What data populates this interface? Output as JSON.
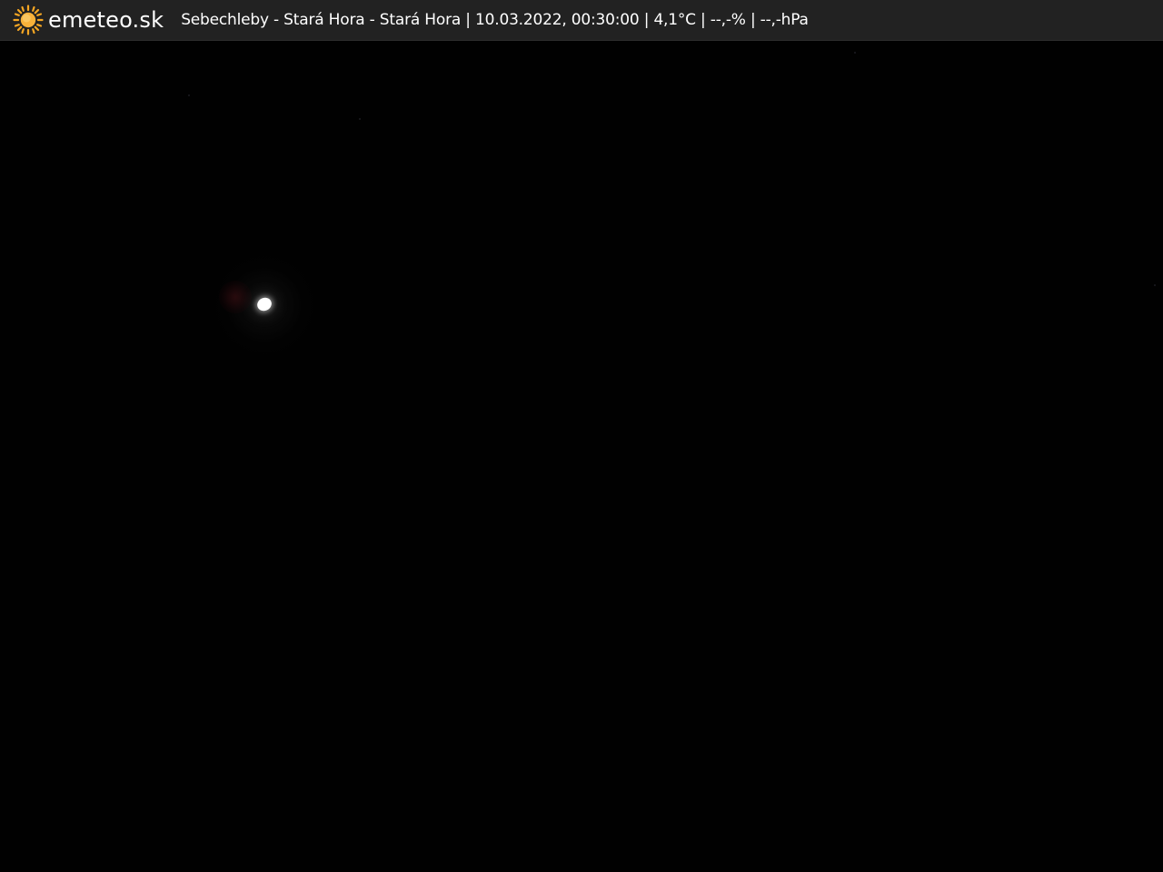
{
  "header": {
    "brand": "emeteo.sk",
    "logo_icon": "sun-icon",
    "caption": "Sebechleby - Stará Hora - Stará Hora | 10.03.2022, 00:30:00 | 4,1°C | --,-% | --,-hPa"
  },
  "colors": {
    "bar_background": "#222222",
    "sun": "#f5a623",
    "sky": "#010101"
  }
}
